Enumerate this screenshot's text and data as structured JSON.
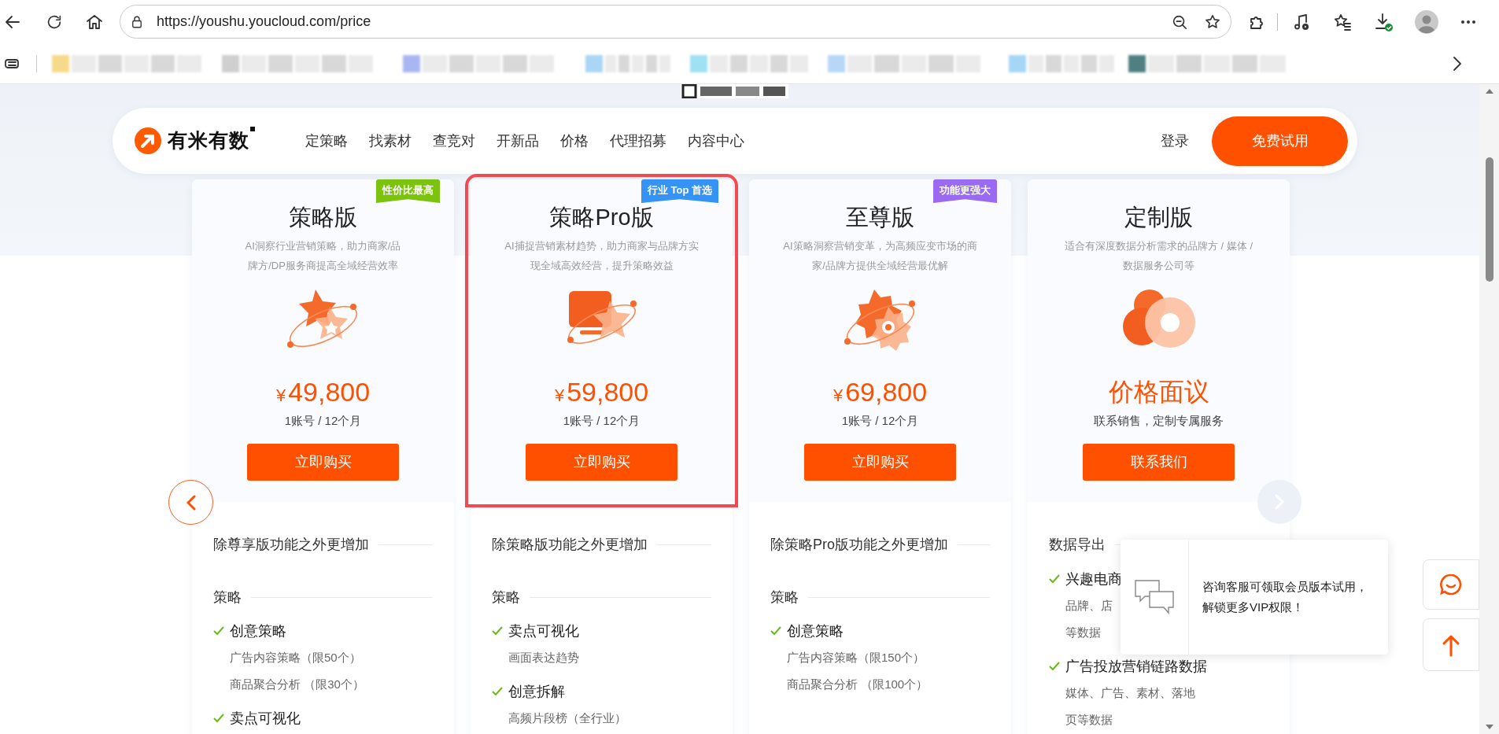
{
  "browser": {
    "url": "https://youshu.youcloud.com/price"
  },
  "nav": {
    "logo": "有米有数",
    "items": [
      "定策略",
      "找素材",
      "查竞对",
      "开新品",
      "价格",
      "代理招募",
      "内容中心"
    ],
    "login": "登录",
    "cta": "免费试用"
  },
  "plans": [
    {
      "badge": {
        "text": "性价比最高",
        "color": "#7cc30f"
      },
      "title": "策略版",
      "description": "AI洞察行业营销策略，助力商家/品牌方/DP服务商提高全域经营效率",
      "price": {
        "currency": "¥",
        "amount": "49,800"
      },
      "period": "1账号 / 12个月",
      "button": "立即购买",
      "selected": false,
      "heading": "除尊享版功能之外更增加",
      "groups": [
        {
          "title": "策略",
          "features": [
            {
              "name": "创意策略",
              "details": [
                "广告内容策略（限50个）",
                "商品聚合分析 （限30个）"
              ]
            },
            {
              "name": "卖点可视化"
            }
          ]
        }
      ]
    },
    {
      "badge": {
        "text": "行业 Top 首选",
        "color": "#3493f5"
      },
      "title": "策略Pro版",
      "description": "AI捕捉营销素材趋势，助力商家与品牌方实现全域高效经营，提升策略效益",
      "price": {
        "currency": "¥",
        "amount": "59,800"
      },
      "period": "1账号 / 12个月",
      "button": "立即购买",
      "selected": true,
      "heading": "除策略版功能之外更增加",
      "groups": [
        {
          "title": "策略",
          "features": [
            {
              "name": "卖点可视化",
              "details": [
                "画面表达趋势"
              ]
            },
            {
              "name": "创意拆解",
              "details": [
                "高频片段榜（全行业）"
              ]
            }
          ]
        }
      ]
    },
    {
      "badge": {
        "text": "功能更强大",
        "color": "#9a6af2"
      },
      "title": "至尊版",
      "description": "AI策略洞察营销变革，为高频应变市场的商家/品牌方提供全域经营最优解",
      "price": {
        "currency": "¥",
        "amount": "69,800"
      },
      "period": "1账号 / 12个月",
      "button": "立即购买",
      "selected": false,
      "heading": "除策略Pro版功能之外更增加",
      "groups": [
        {
          "title": "策略",
          "features": [
            {
              "name": "创意策略",
              "details": [
                "广告内容策略（限150个）",
                "商品聚合分析 （限100个）"
              ]
            }
          ]
        }
      ]
    },
    {
      "title": "定制版",
      "description": "适合有深度数据分析需求的品牌方 / 媒体 / 数据服务公司等",
      "price": {
        "amount": "价格面议"
      },
      "period": "联系销售，定制专属服务",
      "button": "联系我们",
      "selected": false,
      "heading": "数据导出",
      "groups": [
        {
          "features": [
            {
              "name": "兴趣电商",
              "details": [
                "品牌、店",
                "等数据"
              ]
            },
            {
              "name": "广告投放营销链路数据",
              "details": [
                "媒体、广告、素材、落地",
                "页等数据"
              ]
            }
          ]
        }
      ]
    }
  ],
  "chat_tip": {
    "text": "咨询客服可领取会员版本试用，解锁更多VIP权限！"
  }
}
